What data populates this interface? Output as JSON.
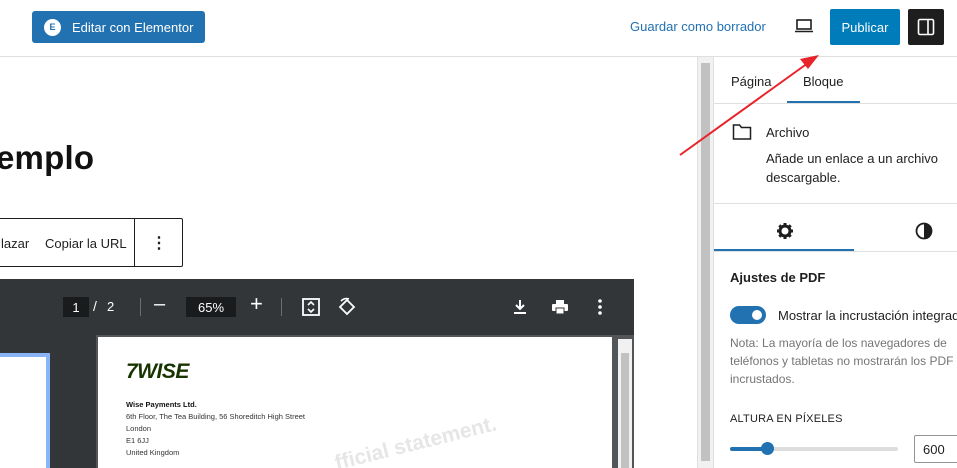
{
  "topbar": {
    "elementor_label": "Editar con Elementor",
    "draft_label": "Guardar como borrador",
    "publish_label": "Publicar",
    "accent": "#2271b1"
  },
  "canvas": {
    "page_title": "emplo",
    "toolbar": {
      "replace_label": "lazar",
      "copy_url_label": "Copiar la URL",
      "more_icon": "⋮"
    }
  },
  "pdf": {
    "current_page": "1",
    "separator": "/",
    "total_pages": "2",
    "zoom": "65%",
    "logo": "7WISE",
    "company": "Wise Payments Ltd.",
    "address": [
      "6th Floor, The Tea Building, 56 Shoreditch High Street",
      "London",
      "E1 6JJ",
      "United Kingdom"
    ],
    "watermark": "fficial statement."
  },
  "sidebar": {
    "tabs": [
      "Página",
      "Bloque"
    ],
    "block_title": "Archivo",
    "block_desc": "Añade un enlace a un archivo descargable.",
    "section_title": "Ajustes de PDF",
    "toggle_label": "Mostrar la incrustación integrada",
    "note": "Nota: La mayoría de los navegadores de teléfonos y tabletas no mostrarán los PDF incrustados.",
    "height_label": "ALTURA EN PÍXELES",
    "height_value": "600",
    "height_fraction": 0.22
  }
}
